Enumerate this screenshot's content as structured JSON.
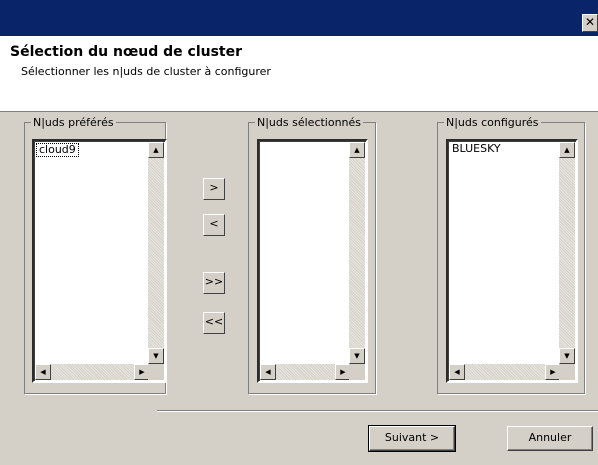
{
  "window": {
    "close_glyph": "✕"
  },
  "header": {
    "title": "Sélection du nœud de cluster",
    "subtitle": "Sélectionner les n|uds de cluster à configurer"
  },
  "groups": {
    "preferred": {
      "label": "N|uds préférés",
      "items": [
        "cloud9"
      ]
    },
    "selected": {
      "label": "N|uds sélectionnés",
      "items": []
    },
    "configured": {
      "label": "N|uds configurés",
      "items": [
        "BLUESKY"
      ]
    }
  },
  "move_buttons": {
    "add": ">",
    "remove": "<",
    "add_all": ">>",
    "remove_all": "<<"
  },
  "scroll_glyphs": {
    "up": "▲",
    "down": "▼",
    "left": "◀",
    "right": "▶"
  },
  "footer": {
    "next_label": "Suivant >",
    "cancel_label": "Annuler"
  }
}
